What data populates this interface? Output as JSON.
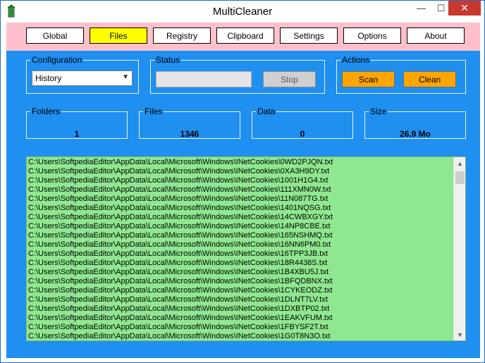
{
  "window": {
    "title": "MultiCleaner",
    "minimize_glyph": "—",
    "maximize_glyph": "☐",
    "close_glyph": "✕",
    "app_icon": "trash-can-icon"
  },
  "tabs": [
    {
      "label": "Global"
    },
    {
      "label": "Files",
      "active": true
    },
    {
      "label": "Registry"
    },
    {
      "label": "Clipboard"
    },
    {
      "label": "Settings"
    },
    {
      "label": "Options"
    },
    {
      "label": "About"
    }
  ],
  "configuration": {
    "legend": "Configuration",
    "selected": "History"
  },
  "status": {
    "legend": "Status",
    "value": "",
    "stop_label": "Stop"
  },
  "actions": {
    "legend": "Actions",
    "scan_label": "Scan",
    "clean_label": "Clean"
  },
  "stats": {
    "folders": {
      "label": "Folders",
      "value": "1"
    },
    "files": {
      "label": "Files",
      "value": "1346"
    },
    "data": {
      "label": "Data",
      "value": "0"
    },
    "size": {
      "label": "Size",
      "value": "26.9 Mo"
    }
  },
  "file_list": [
    "C:\\Users\\SoftpediaEditor\\AppData\\Local\\Microsoft\\Windows\\INetCookies\\0WD2PJQN.txt",
    "C:\\Users\\SoftpediaEditor\\AppData\\Local\\Microsoft\\Windows\\INetCookies\\0XA3H9DY.txt",
    "C:\\Users\\SoftpediaEditor\\AppData\\Local\\Microsoft\\Windows\\INetCookies\\1001H1G4.txt",
    "C:\\Users\\SoftpediaEditor\\AppData\\Local\\Microsoft\\Windows\\INetCookies\\111XMN0W.txt",
    "C:\\Users\\SoftpediaEditor\\AppData\\Local\\Microsoft\\Windows\\INetCookies\\11N087TG.txt",
    "C:\\Users\\SoftpediaEditor\\AppData\\Local\\Microsoft\\Windows\\INetCookies\\1401NQSG.txt",
    "C:\\Users\\SoftpediaEditor\\AppData\\Local\\Microsoft\\Windows\\INetCookies\\14CWBXGY.txt",
    "C:\\Users\\SoftpediaEditor\\AppData\\Local\\Microsoft\\Windows\\INetCookies\\14NP8CBE.txt",
    "C:\\Users\\SoftpediaEditor\\AppData\\Local\\Microsoft\\Windows\\INetCookies\\165NSHMQ.txt",
    "C:\\Users\\SoftpediaEditor\\AppData\\Local\\Microsoft\\Windows\\INetCookies\\16NN6PM0.txt",
    "C:\\Users\\SoftpediaEditor\\AppData\\Local\\Microsoft\\Windows\\INetCookies\\16TPP3JB.txt",
    "C:\\Users\\SoftpediaEditor\\AppData\\Local\\Microsoft\\Windows\\INetCookies\\18R4438S.txt",
    "C:\\Users\\SoftpediaEditor\\AppData\\Local\\Microsoft\\Windows\\INetCookies\\1B4XBU5J.txt",
    "C:\\Users\\SoftpediaEditor\\AppData\\Local\\Microsoft\\Windows\\INetCookies\\1BFQDBNX.txt",
    "C:\\Users\\SoftpediaEditor\\AppData\\Local\\Microsoft\\Windows\\INetCookies\\1CYKEODZ.txt",
    "C:\\Users\\SoftpediaEditor\\AppData\\Local\\Microsoft\\Windows\\INetCookies\\1DLNT7LV.txt",
    "C:\\Users\\SoftpediaEditor\\AppData\\Local\\Microsoft\\Windows\\INetCookies\\1DXBTP02.txt",
    "C:\\Users\\SoftpediaEditor\\AppData\\Local\\Microsoft\\Windows\\INetCookies\\1EAKVFUM.txt",
    "C:\\Users\\SoftpediaEditor\\AppData\\Local\\Microsoft\\Windows\\INetCookies\\1FBYSF2T.txt",
    "C:\\Users\\SoftpediaEditor\\AppData\\Local\\Microsoft\\Windows\\INetCookies\\1G0T8N3O.txt"
  ],
  "scrollbar": {
    "up_glyph": "▲",
    "down_glyph": "▼"
  },
  "colors": {
    "client_bg": "#1f8ff0",
    "tabbar_bg": "#ffc0cb",
    "active_tab": "#ffff00",
    "action_button": "#ffa500",
    "list_bg": "#8fe88f",
    "close_button": "#c7392f"
  }
}
